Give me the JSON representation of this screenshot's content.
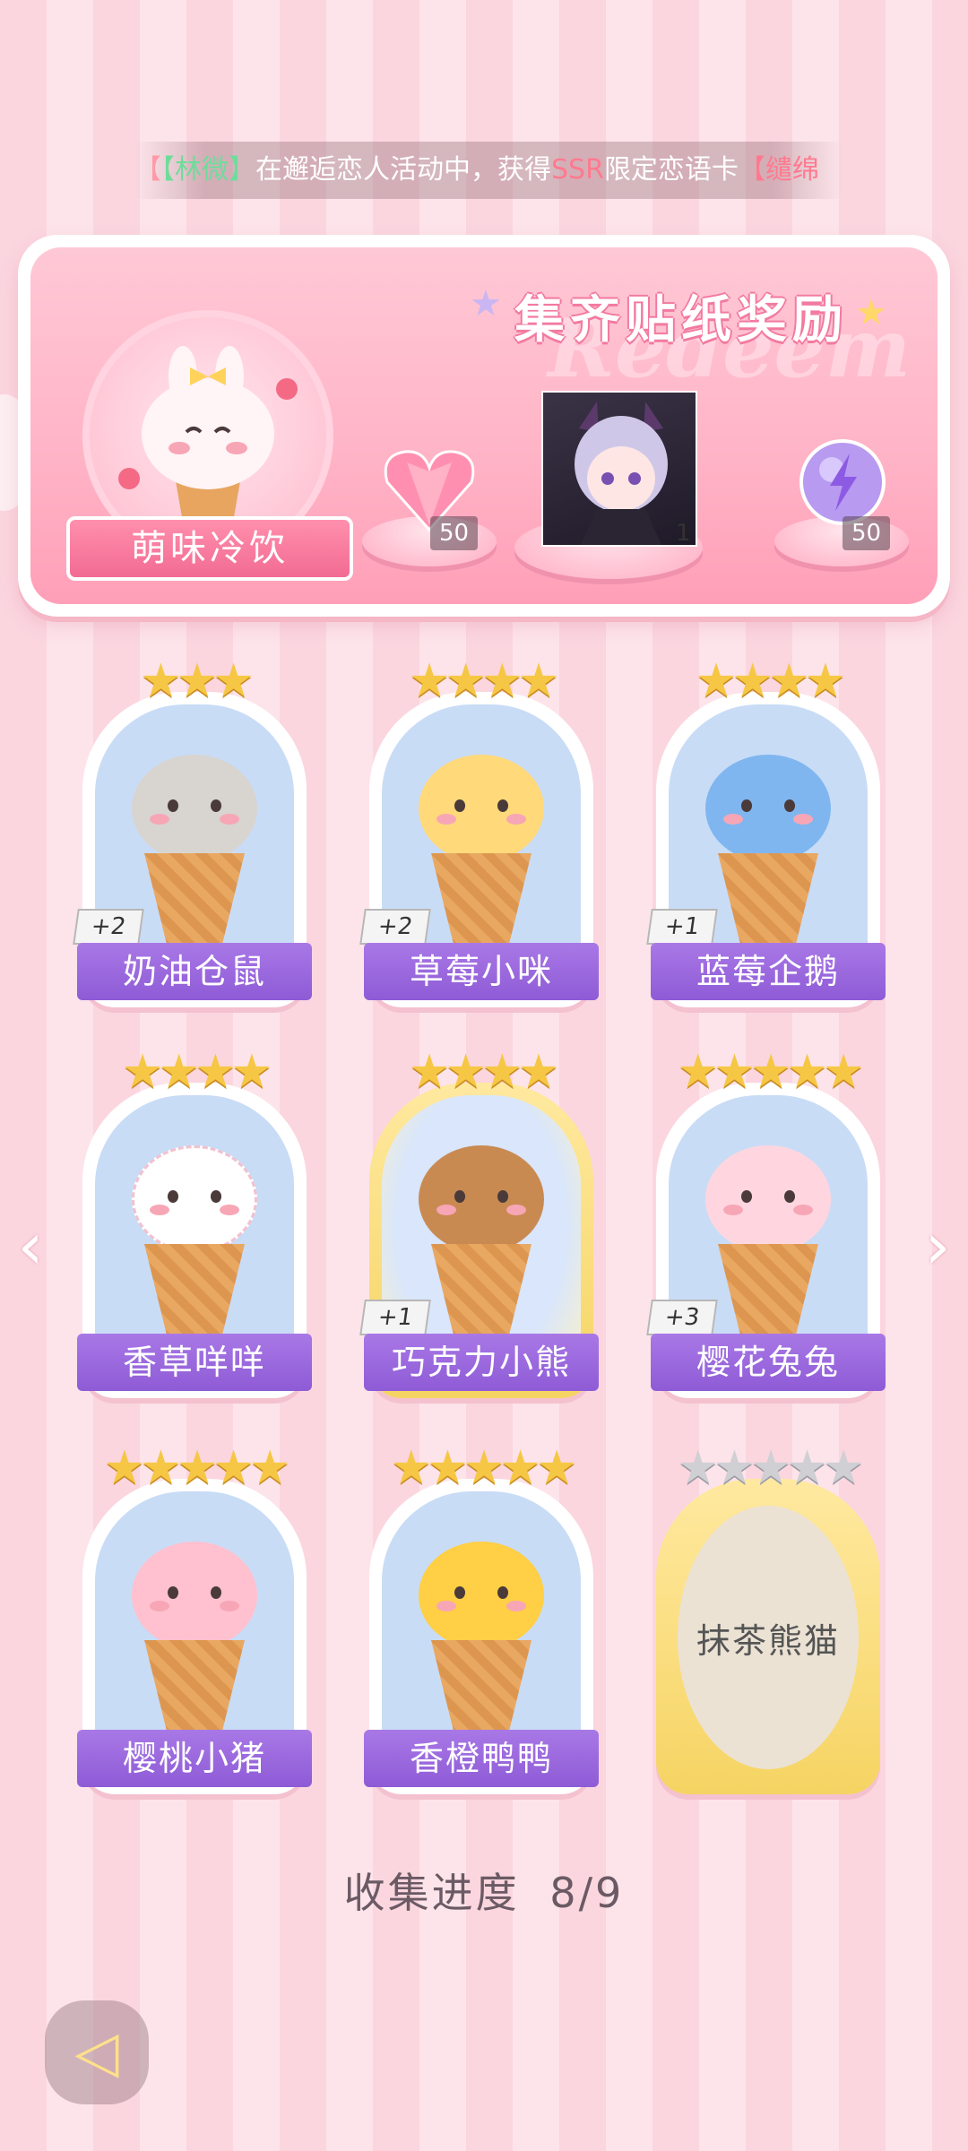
{
  "marquee": {
    "prefix": "【",
    "name": "【林微】",
    "middle": "在邂逅恋人活动中，获得",
    "rarity": "SSR",
    "after": "限定恋语卡",
    "card": "【缱绵"
  },
  "banner": {
    "title": "集齐贴纸奖励",
    "watermark": "Redeem",
    "set_name": "萌味冷饮",
    "rewards": [
      {
        "icon": "pink-diamond-heart-icon",
        "count": "50"
      },
      {
        "icon": "character-portrait-icon",
        "count": "1"
      },
      {
        "icon": "purple-energy-orb-icon",
        "count": "50"
      }
    ]
  },
  "stickers": [
    {
      "name": "奶油仓鼠",
      "stars": "★★★",
      "bonus": "+2",
      "icon": "hamster-icecream-icon"
    },
    {
      "name": "草莓小咪",
      "stars": "★★★★",
      "bonus": "+2",
      "icon": "cat-icecream-icon"
    },
    {
      "name": "蓝莓企鹅",
      "stars": "★★★★",
      "bonus": "+1",
      "icon": "penguin-icecream-icon"
    },
    {
      "name": "香草咩咩",
      "stars": "★★★★",
      "bonus": "",
      "icon": "sheep-icecream-icon"
    },
    {
      "name": "巧克力小熊",
      "stars": "★★★★",
      "bonus": "+1",
      "icon": "bear-icecream-icon"
    },
    {
      "name": "樱花兔兔",
      "stars": "★★★★★",
      "bonus": "+3",
      "icon": "rabbit-icecream-icon"
    },
    {
      "name": "樱桃小猪",
      "stars": "★★★★★",
      "bonus": "",
      "icon": "pig-icecream-icon"
    },
    {
      "name": "香橙鸭鸭",
      "stars": "★★★★★",
      "bonus": "",
      "icon": "duck-icecream-icon"
    },
    {
      "name": "抹茶熊猫",
      "stars": "★★★★★",
      "bonus": "",
      "icon": "locked-sticker-icon"
    }
  ],
  "progress": {
    "label": "收集进度",
    "value": "8/9"
  },
  "colors": {
    "name_bar": "#9a68de",
    "banner_pink": "#ffb3c6",
    "star_gold": "#f6c745"
  }
}
